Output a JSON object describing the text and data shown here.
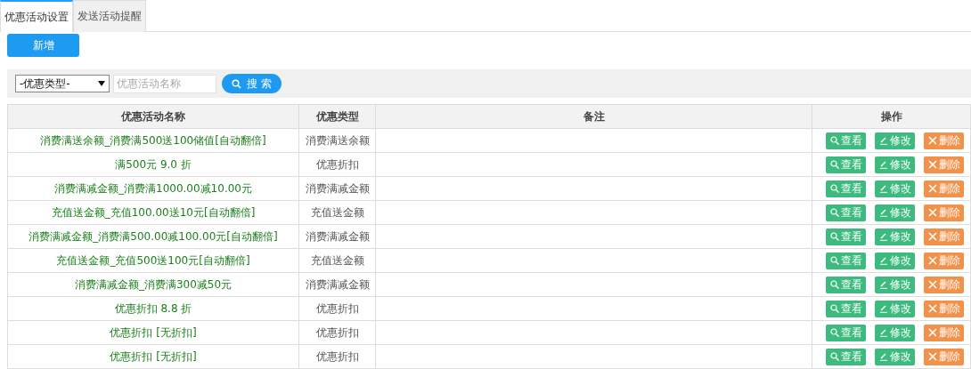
{
  "tabs": [
    {
      "label": "优惠活动设置",
      "selected": true
    },
    {
      "label": "发送活动提醒",
      "selected": false
    }
  ],
  "add_button": "新增",
  "filter": {
    "type_select": "-优惠类型-",
    "name_field": {
      "placeholder": "优惠活动名称"
    },
    "search_button": "搜 索"
  },
  "table": {
    "columns": [
      "优惠活动名称",
      "优惠类型",
      "备注",
      "操作"
    ],
    "rows": [
      {
        "name": "消费满送余额_消费满500送100储值[自动翻倍]",
        "type": "消费满送余额",
        "actions": [
          {
            "kind": "view",
            "label": "查看"
          },
          {
            "kind": "edit",
            "label": "修改"
          },
          {
            "kind": "delete",
            "label": "删除"
          }
        ]
      },
      {
        "name": "满500元 9.0 折",
        "type": "优惠折扣",
        "actions": [
          {
            "kind": "view",
            "label": "查看"
          },
          {
            "kind": "edit",
            "label": "修改"
          },
          {
            "kind": "delete",
            "label": "删除"
          }
        ]
      },
      {
        "name": "消费满减金额_消费满1000.00减10.00元",
        "type": "消费满减金额",
        "actions": [
          {
            "kind": "view",
            "label": "查看"
          },
          {
            "kind": "edit",
            "label": "修改"
          },
          {
            "kind": "delete",
            "label": "删除"
          }
        ]
      },
      {
        "name": "充值送金额_充值100.00送10元[自动翻倍]",
        "type": "充值送金额",
        "actions": [
          {
            "kind": "view",
            "label": "查看"
          },
          {
            "kind": "edit",
            "label": "修改"
          },
          {
            "kind": "delete",
            "label": "删除"
          }
        ]
      },
      {
        "name": "消费满减金额_消费满500.00减100.00元[自动翻倍]",
        "type": "消费满减金额",
        "actions": [
          {
            "kind": "view",
            "label": "查看"
          },
          {
            "kind": "edit",
            "label": "修改"
          },
          {
            "kind": "delete",
            "label": "删除"
          }
        ]
      },
      {
        "name": "充值送金额_充值500送100元[自动翻倍]",
        "type": "充值送金额",
        "actions": [
          {
            "kind": "view",
            "label": "查看"
          },
          {
            "kind": "edit",
            "label": "修改"
          },
          {
            "kind": "delete",
            "label": "删除"
          }
        ]
      },
      {
        "name": "消费满减金额_消费满300减50元",
        "type": "消费满减金额",
        "actions": [
          {
            "kind": "view",
            "label": "查看"
          },
          {
            "kind": "edit",
            "label": "修改"
          },
          {
            "kind": "delete",
            "label": "删除"
          }
        ]
      },
      {
        "name": "优惠折扣 8.8 折",
        "type": "优惠折扣",
        "actions": [
          {
            "kind": "view",
            "label": "查看"
          },
          {
            "kind": "edit",
            "label": "修改"
          },
          {
            "kind": "delete",
            "label": "删除"
          }
        ]
      },
      {
        "name": "优惠折扣 [无折扣]",
        "type": "优惠折扣",
        "actions": [
          {
            "kind": "view",
            "label": "查看"
          },
          {
            "kind": "edit",
            "label": "修改"
          },
          {
            "kind": "delete",
            "label": "删除"
          }
        ]
      },
      {
        "name": "优惠折扣 [无折扣]",
        "type": "优惠折扣",
        "actions": [
          {
            "kind": "view",
            "label": "查看"
          },
          {
            "kind": "edit",
            "label": "修改"
          },
          {
            "kind": "delete",
            "label": "删除"
          }
        ]
      }
    ]
  }
}
